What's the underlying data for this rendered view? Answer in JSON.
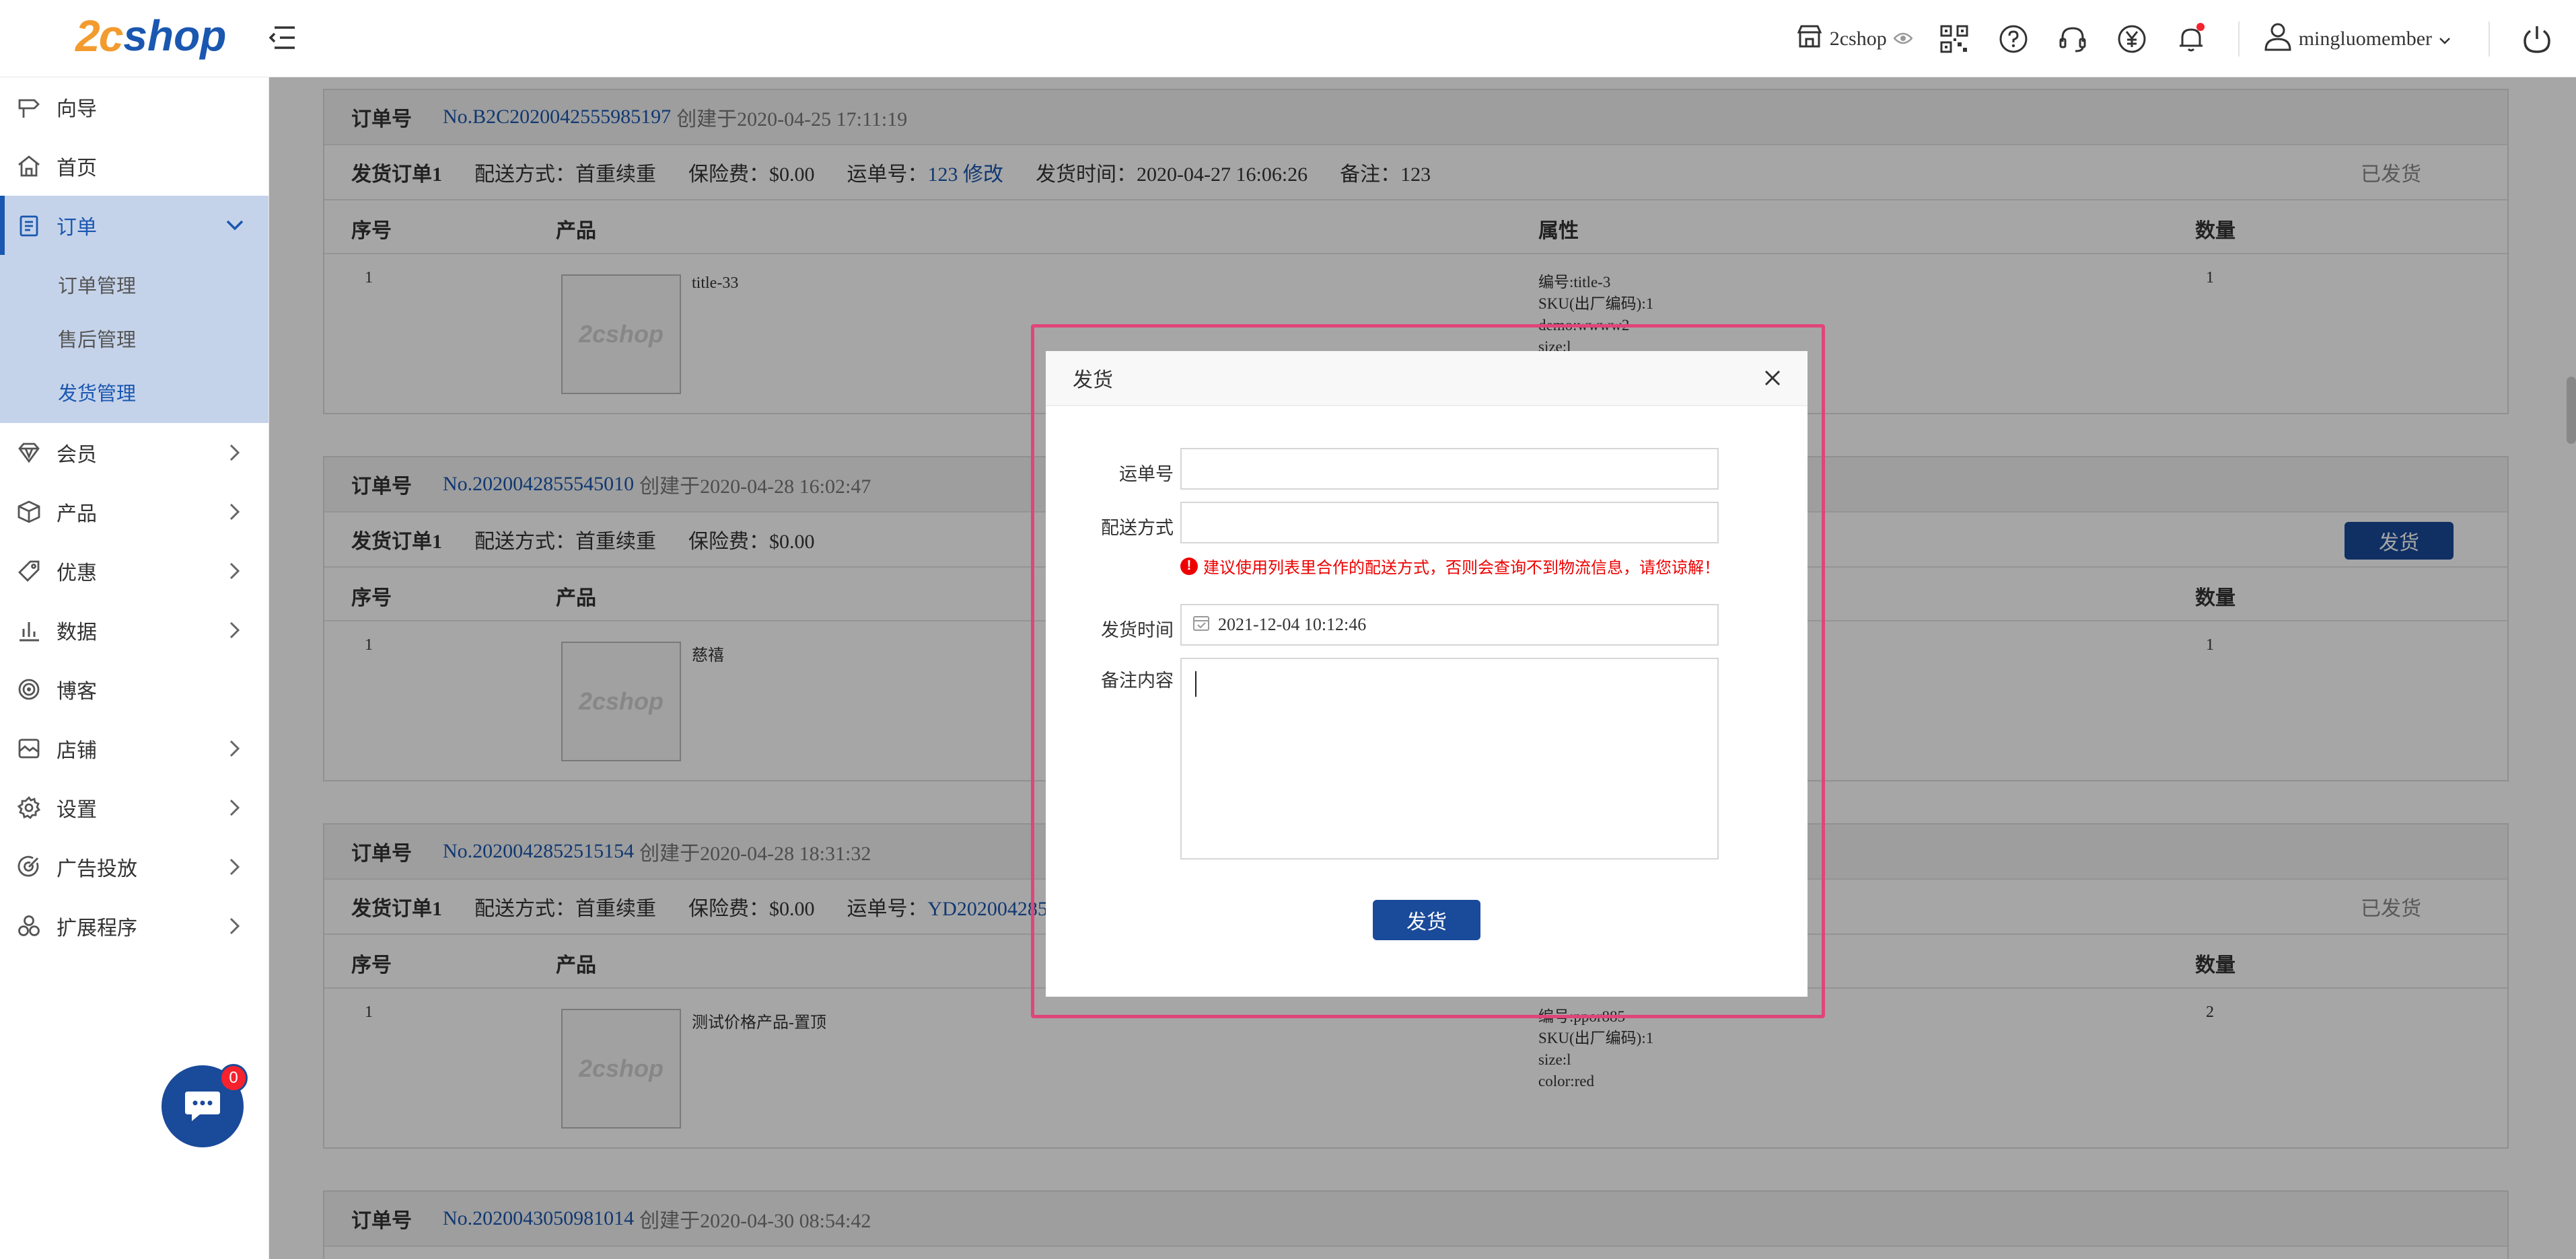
{
  "header": {
    "logo_mark": "2c",
    "logo_text": "shop",
    "store_name": "2cshop",
    "username": "mingluomember",
    "icons": [
      "store-icon",
      "eye-icon",
      "qrcode-icon",
      "help-icon",
      "headset-icon",
      "yen-icon",
      "bell-icon",
      "user-icon",
      "power-icon"
    ]
  },
  "sidebar": {
    "items": [
      {
        "label": "向导",
        "icon": "signpost-icon"
      },
      {
        "label": "首页",
        "icon": "home-icon"
      },
      {
        "label": "订单",
        "icon": "clipboard-icon",
        "expanded": true
      },
      {
        "label": "会员",
        "icon": "diamond-icon"
      },
      {
        "label": "产品",
        "icon": "box-icon"
      },
      {
        "label": "优惠",
        "icon": "tag-icon"
      },
      {
        "label": "数据",
        "icon": "bar-chart-icon"
      },
      {
        "label": "博客",
        "icon": "target-icon"
      },
      {
        "label": "店铺",
        "icon": "shop-icon"
      },
      {
        "label": "设置",
        "icon": "gear-icon"
      },
      {
        "label": "广告投放",
        "icon": "bullseye-icon"
      },
      {
        "label": "扩展程序",
        "icon": "modules-icon"
      }
    ],
    "order_sub": [
      "订单管理",
      "售后管理",
      "发货管理"
    ]
  },
  "chat": {
    "badge": "0"
  },
  "orders": {
    "order_label": "订单号",
    "columns": {
      "seq": "序号",
      "product": "产品",
      "attr": "属性",
      "qty": "数量"
    },
    "thumb_text": "2cshop",
    "list": [
      {
        "no": "No.B2C2020042555985197",
        "created": "创建于2020-04-25 17:11:19",
        "ship_title": "发货订单1",
        "delivery": "配送方式：首重续重",
        "insurance": "保险费：$0.00",
        "waybill_label": "运单号：",
        "waybill": "123 修改",
        "ship_time": "发货时间：2020-04-27 16:06:26",
        "remark": "备注：123",
        "status": "已发货",
        "row": {
          "seq": "1",
          "product": "title-33",
          "attrs": [
            "编号:title-3",
            "SKU(出厂编码):1",
            "demo:wwww2",
            "size:l"
          ],
          "qty": "1"
        }
      },
      {
        "no": "No.2020042855545010",
        "created": "创建于2020-04-28 16:02:47",
        "ship_title": "发货订单1",
        "delivery": "配送方式：首重续重",
        "insurance": "保险费：$0.00",
        "button": "发货",
        "row": {
          "seq": "1",
          "product": "慈禧",
          "qty": "1"
        }
      },
      {
        "no": "No.2020042852515154",
        "created": "创建于2020-04-28 18:31:32",
        "ship_title": "发货订单1",
        "delivery": "配送方式：首重续重",
        "insurance": "保险费：$0.00",
        "waybill_label": "运单号：",
        "waybill": "YD20200428525154",
        "status": "已发货",
        "row": {
          "seq": "1",
          "product": "测试价格产品-置顶",
          "attrs": [
            "编号:ppor885",
            "SKU(出厂编码):1",
            "size:l",
            "color:red"
          ],
          "qty": "2"
        }
      },
      {
        "no": "No.2020043050981014",
        "created": "创建于2020-04-30 08:54:42"
      }
    ]
  },
  "modal": {
    "title": "发货",
    "waybill_label": "运单号",
    "waybill_value": "",
    "delivery_label": "配送方式",
    "delivery_value": "",
    "warning": "建议使用列表里合作的配送方式，否则会查询不到物流信息，请您谅解！",
    "time_label": "发货时间",
    "time_value": "2021-12-04 10:12:46",
    "remark_label": "备注内容",
    "remark_value": "",
    "submit": "发货"
  },
  "colors": {
    "brand_blue": "#1a57b0",
    "brand_orange": "#f39b2f",
    "button_blue": "#1a4a9a",
    "highlight": "#e0457a",
    "warning": "#ee0000"
  }
}
